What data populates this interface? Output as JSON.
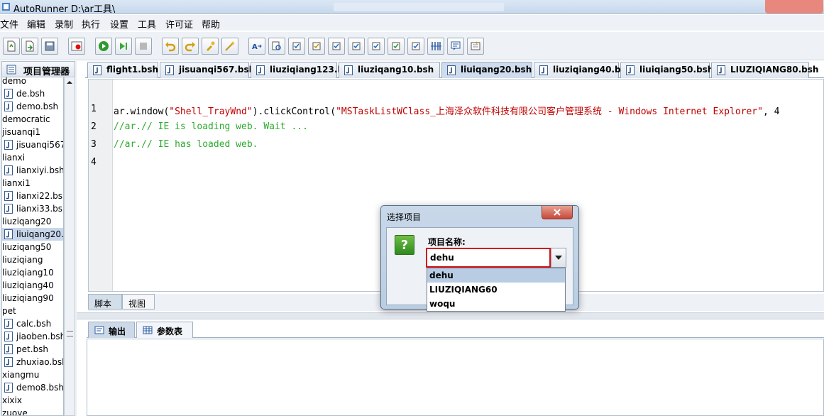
{
  "window": {
    "title": "AutoRunner  D:\\ar工具\\"
  },
  "menu": [
    "文件",
    "编辑",
    "录制",
    "执行",
    "设置",
    "工具",
    "许可证",
    "帮助"
  ],
  "toolbar_icons": [
    "new-file-icon",
    "export-icon",
    "save-icon",
    "record-icon",
    "run-icon",
    "run-step-icon",
    "stop-icon",
    "undo-icon",
    "redo-icon",
    "plugin-icon",
    "magic-icon",
    "text-replace-icon",
    "object-find-icon",
    "check-1-icon",
    "check-2-icon",
    "check-3-icon",
    "check-4-icon",
    "check-5-icon",
    "check-6-icon",
    "check-7-icon",
    "columns-icon",
    "comment-icon",
    "settings-icon"
  ],
  "project_panel": {
    "title": "项目管理器",
    "tree": [
      {
        "label": "demo",
        "type": "folder"
      },
      {
        "label": "de.bsh",
        "type": "file"
      },
      {
        "label": "demo.bsh",
        "type": "file"
      },
      {
        "label": "democratic",
        "type": "folder"
      },
      {
        "label": "jisuanqi1",
        "type": "folder"
      },
      {
        "label": "jisuanqi567.",
        "type": "file"
      },
      {
        "label": "lianxi",
        "type": "folder"
      },
      {
        "label": "lianxiyi.bsh",
        "type": "file"
      },
      {
        "label": "lianxi1",
        "type": "folder"
      },
      {
        "label": "lianxi22.bsh",
        "type": "file"
      },
      {
        "label": "lianxi33.bsh",
        "type": "file"
      },
      {
        "label": "liuziqang20",
        "type": "folder"
      },
      {
        "label": "liuiqang20.b",
        "type": "file",
        "selected": true
      },
      {
        "label": "liuziqang50",
        "type": "folder"
      },
      {
        "label": "liuziqiang",
        "type": "folder"
      },
      {
        "label": "liuziqiang10",
        "type": "folder"
      },
      {
        "label": "liuziqiang40",
        "type": "folder"
      },
      {
        "label": "liuziqiang90",
        "type": "folder"
      },
      {
        "label": "pet",
        "type": "folder"
      },
      {
        "label": "calc.bsh",
        "type": "file"
      },
      {
        "label": "jiaoben.bsh",
        "type": "file"
      },
      {
        "label": "pet.bsh",
        "type": "file"
      },
      {
        "label": "zhuxiao.bsh",
        "type": "file"
      },
      {
        "label": "xiangmu",
        "type": "folder"
      },
      {
        "label": "demo8.bsh",
        "type": "file"
      },
      {
        "label": "xixix",
        "type": "folder"
      },
      {
        "label": "zuoye",
        "type": "folder"
      }
    ]
  },
  "editor_tabs": [
    {
      "label": "flight1.bsh"
    },
    {
      "label": "jisuanqi567.bsh"
    },
    {
      "label": "liuziqiang123.bsh"
    },
    {
      "label": "liuziqang10.bsh"
    },
    {
      "label": "liuiqang20.bsh",
      "active": true
    },
    {
      "label": "liuziqiang40.bsh"
    },
    {
      "label": "liuiqiang50.bsh"
    },
    {
      "label": "LIUZIQIANG80.bsh"
    }
  ],
  "code": {
    "line_numbers": [
      "1",
      "2",
      "3",
      "4"
    ],
    "line1_a": "ar.window(",
    "line1_b": "\"Shell_TrayWnd\"",
    "line1_c": ").clickControl(",
    "line1_d": "\"MSTaskListWClass_上海泽众软件科技有限公司客户管理系统 - Windows Internet Explorer\"",
    "line1_e": ", 4",
    "line2": "//ar.// IE is loading web. Wait ...",
    "line3": "//ar.// IE has loaded web."
  },
  "view_tabs": {
    "script": "脚本",
    "view": "视图"
  },
  "output_tabs": {
    "output": "输出",
    "params": "参数表"
  },
  "dialog": {
    "title": "选择项目",
    "label": "项目名称:",
    "input_value": "dehu",
    "options": [
      "dehu",
      "LIUZIQIANG60",
      "woqu"
    ],
    "selected_index": 0
  },
  "colors": {
    "string": "#c00000",
    "comment": "#2eaa2e",
    "input_border": "#d1151c",
    "dropdown_selected": "#b8cce4"
  }
}
